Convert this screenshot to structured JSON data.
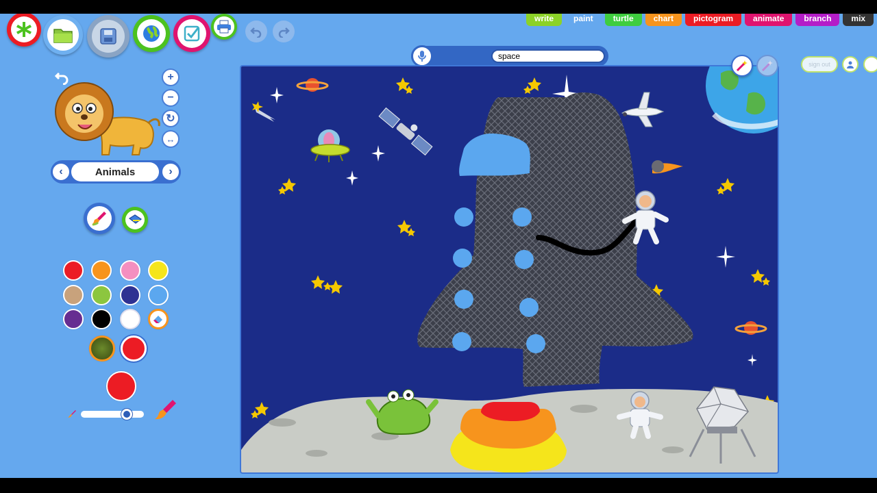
{
  "toolbar": {
    "new": "new-icon",
    "open": "folder-icon",
    "save": "save-icon",
    "share": "globe-icon",
    "check": "check-icon",
    "print": "printer-icon",
    "undo": "undo-icon",
    "redo": "redo-icon"
  },
  "tabs": [
    {
      "label": "write",
      "color": "#8cd227"
    },
    {
      "label": "paint",
      "color": "#65a8ee"
    },
    {
      "label": "turtle",
      "color": "#3fcd3f"
    },
    {
      "label": "chart",
      "color": "#f7941d"
    },
    {
      "label": "pictogram",
      "color": "#ec1c24"
    },
    {
      "label": "animate",
      "color": "#e0146f"
    },
    {
      "label": "branch",
      "color": "#b41ec8"
    },
    {
      "label": "mix",
      "color": "#333333"
    }
  ],
  "search": {
    "value": "space"
  },
  "header": {
    "signout_label": "sign out"
  },
  "left_panel": {
    "category_label": "Animals",
    "zoom": [
      "+",
      "−",
      "↻",
      "↔"
    ],
    "colors": [
      "#ec1c24",
      "#f7941d",
      "#f48fc0",
      "#f5e51b",
      "#c8a27c",
      "#8cc63f",
      "#2e3192",
      "#5ba7ef",
      "#662d91",
      "#000000",
      "#ffffff"
    ],
    "current_color": "#ec1c24"
  }
}
